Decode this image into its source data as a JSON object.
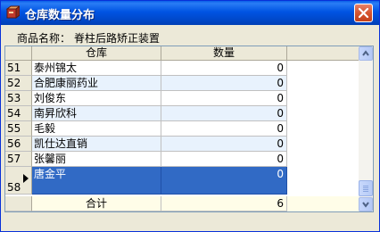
{
  "window": {
    "title": "仓库数量分布",
    "colors": {
      "titlebar": "#0054e3",
      "close": "#d5552f",
      "selection": "#316ac5",
      "alt_row": "#e8f2fd"
    }
  },
  "product": {
    "label": "商品名称：",
    "value": "脊柱后路矫正装置"
  },
  "grid": {
    "columns": [
      "仓库",
      "数量"
    ],
    "rows": [
      {
        "num": "51",
        "name": "泰州锦太",
        "qty": "0"
      },
      {
        "num": "52",
        "name": "合肥康丽药业",
        "qty": "0"
      },
      {
        "num": "53",
        "name": "刘俊东",
        "qty": "0"
      },
      {
        "num": "54",
        "name": "南昇欣科",
        "qty": "0"
      },
      {
        "num": "55",
        "name": "毛毅",
        "qty": "0"
      },
      {
        "num": "56",
        "name": "凯仕达直销",
        "qty": "0"
      },
      {
        "num": "57",
        "name": "张馨丽",
        "qty": "0"
      }
    ],
    "selected_row": {
      "num": "58",
      "name": "唐金平",
      "qty": "0"
    },
    "total": {
      "label": "合计",
      "qty": "6"
    }
  }
}
